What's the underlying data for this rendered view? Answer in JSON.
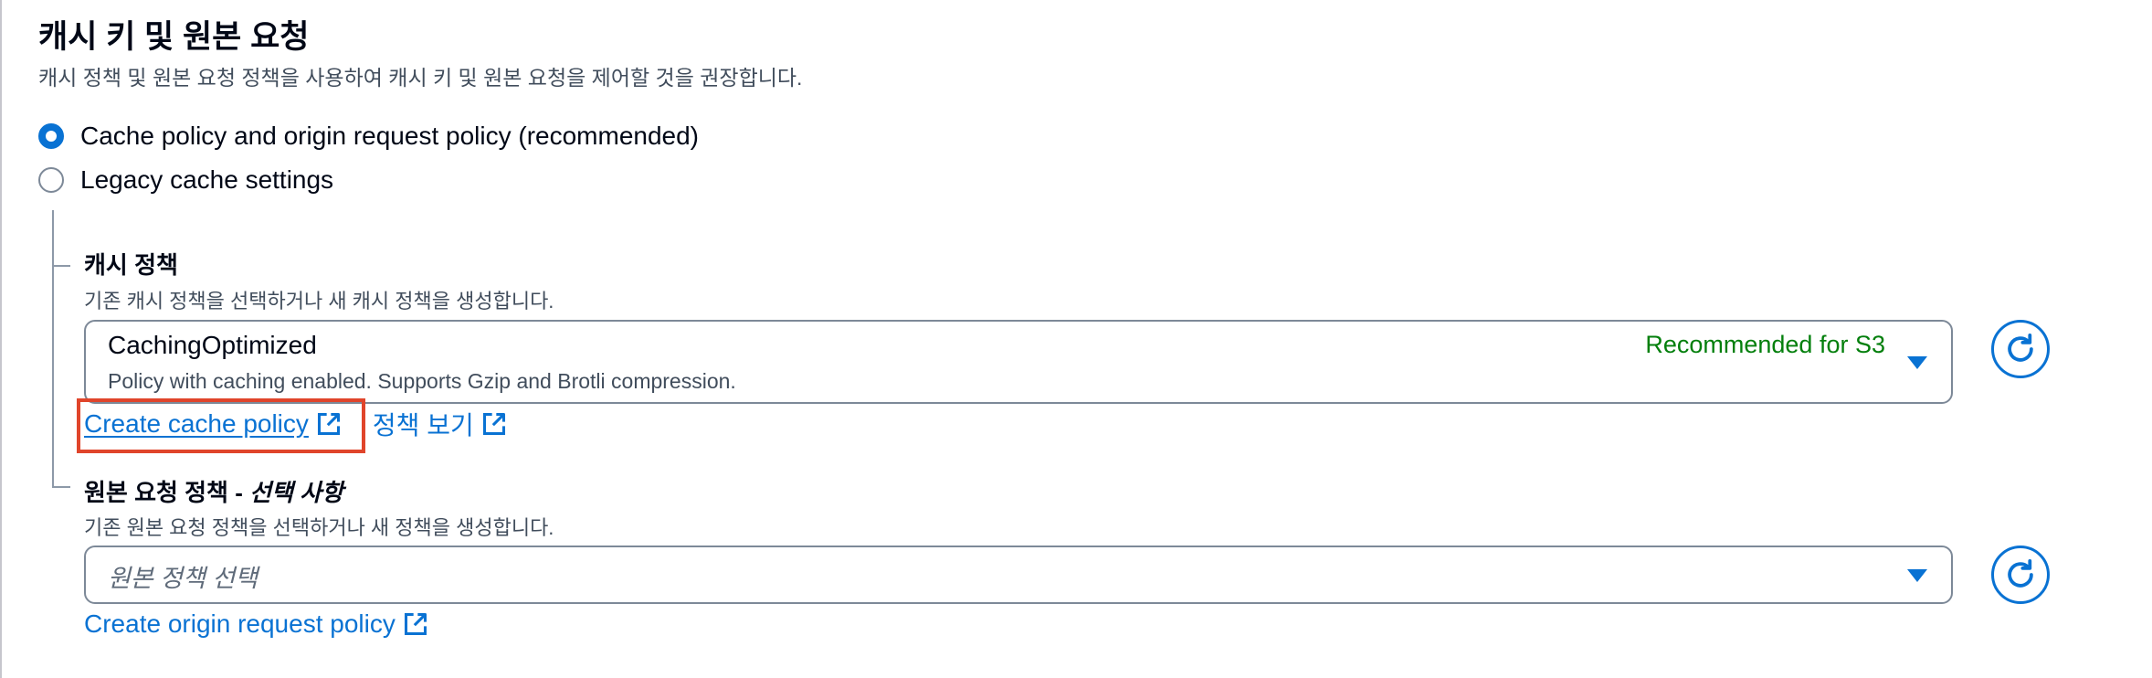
{
  "section": {
    "title": "캐시 키 및 원본 요청",
    "description": "캐시 정책 및 원본 요청 정책을 사용하여 캐시 키 및 원본 요청을 제어할 것을 권장합니다."
  },
  "radio_options": [
    {
      "label": "Cache policy and origin request policy (recommended)",
      "selected": true
    },
    {
      "label": "Legacy cache settings",
      "selected": false
    }
  ],
  "cache_policy": {
    "label": "캐시 정책",
    "description": "기존 캐시 정책을 선택하거나 새 캐시 정책을 생성합니다.",
    "selected_value": "CachingOptimized",
    "selected_description": "Policy with caching enabled. Supports Gzip and Brotli compression.",
    "tag": "Recommended for S3",
    "create_link": "Create cache policy",
    "view_link": "정책 보기"
  },
  "origin_request_policy": {
    "label_main": "원본 요청 정책 - ",
    "label_optional": "선택 사항",
    "description": "기존 원본 요청 정책을 선택하거나 새 정책을 생성합니다.",
    "placeholder": "원본 정책 선택",
    "create_link": "Create origin request policy"
  },
  "colors": {
    "accent": "#0972d3",
    "success": "#037f0c",
    "highlight": "#e0452b",
    "text": "#000716",
    "secondary_text": "#414d5c"
  },
  "icons": {
    "external": "external-link-icon",
    "refresh": "refresh-icon",
    "dropdown": "caret-down-icon"
  }
}
